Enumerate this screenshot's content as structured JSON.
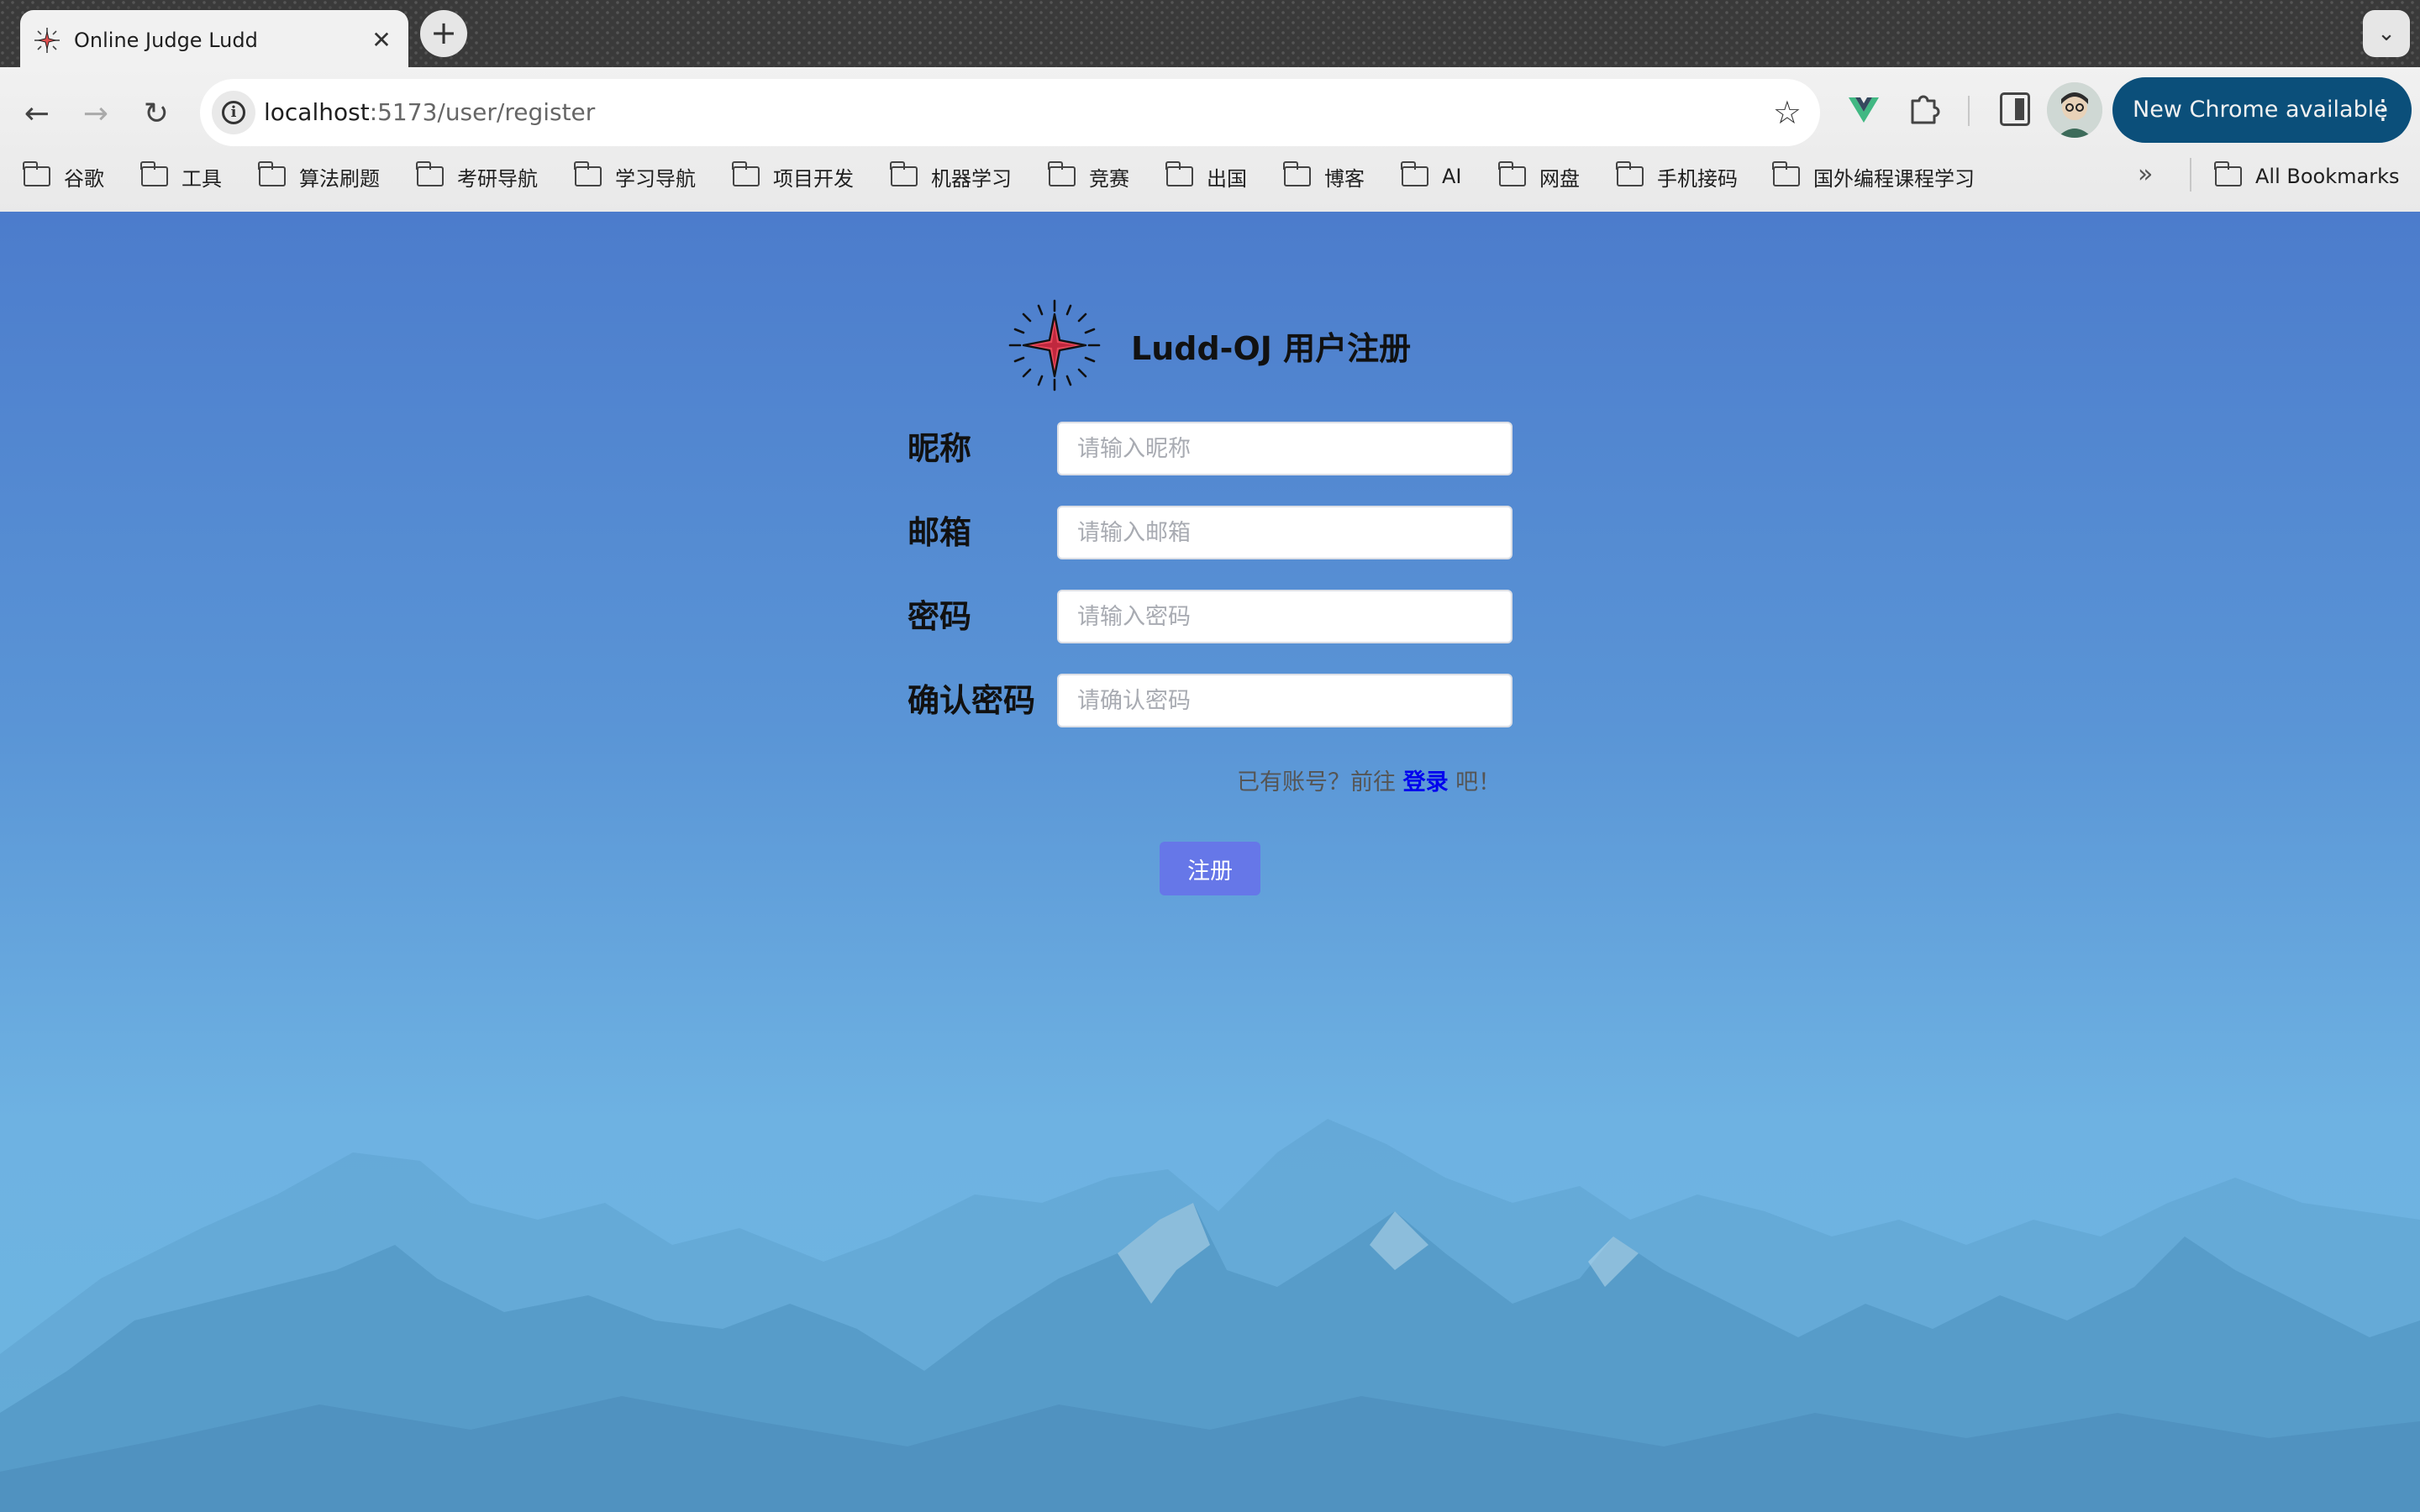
{
  "browser": {
    "tab": {
      "title": "Online Judge Ludd",
      "close_glyph": "✕"
    },
    "new_tab_glyph": "+",
    "tab_search_glyph": "⌄",
    "nav": {
      "back": "←",
      "forward": "→",
      "reload": "↻"
    },
    "url": {
      "host": "localhost",
      "rest": ":5173/user/register"
    },
    "bookmark_star": "☆",
    "update_button": "New Chrome available",
    "update_menu": "⋮",
    "bookmarks": [
      "谷歌",
      "工具",
      "算法刷题",
      "考研导航",
      "学习导航",
      "项目开发",
      "机器学习",
      "竞赛",
      "出国",
      "博客",
      "AI",
      "网盘",
      "手机接码",
      "国外编程课程学习"
    ],
    "bookmarks_overflow": "»",
    "all_bookmarks": "All Bookmarks"
  },
  "page": {
    "title": "Ludd-OJ 用户注册",
    "fields": [
      {
        "label": "昵称",
        "placeholder": "请输入昵称",
        "value": ""
      },
      {
        "label": "邮箱",
        "placeholder": "请输入邮箱",
        "value": ""
      },
      {
        "label": "密码",
        "placeholder": "请输入密码",
        "value": ""
      },
      {
        "label": "确认密码",
        "placeholder": "请确认密码",
        "value": ""
      }
    ],
    "login_hint_prefix": "已有账号？前往 ",
    "login_link": "登录",
    "login_hint_suffix": " 吧！",
    "submit_label": "注册"
  },
  "colors": {
    "submit": "#6677e8",
    "login_link": "#0000ee",
    "update_pill": "#0b4f7a",
    "page_gradient_top": "#4c7ccc",
    "page_gradient_bottom": "#6cb6df"
  },
  "icons": [
    "star-logo-icon",
    "info-icon",
    "bookmark-star-icon",
    "vue-devtools-icon",
    "extensions-icon",
    "side-panel-icon",
    "folder-icon"
  ]
}
